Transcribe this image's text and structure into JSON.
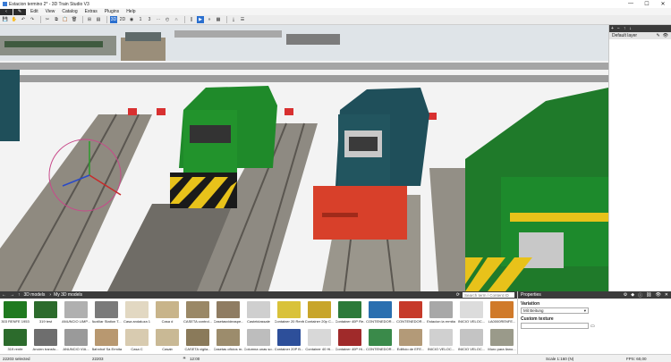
{
  "window": {
    "title": "Estacion termino 2* - 3D Train Studio V3",
    "minimize": "—",
    "maximize": "☐",
    "close": "✕"
  },
  "menu": {
    "back_icon": "arrow-left-icon",
    "edit_icon": "pencil-icon",
    "items": [
      "Edit",
      "View",
      "Catalog",
      "Extras",
      "Plugins",
      "Help"
    ]
  },
  "toolbar": {
    "view_3d": "3D",
    "view_2d": "2D",
    "counter_value": "1",
    "counter_value_2": "3",
    "pause": "||",
    "play": "▶"
  },
  "layers": {
    "default_layer": "Default layer"
  },
  "catalog": {
    "breadcrumb_1": "3D models",
    "breadcrumb_2": "My 3D models",
    "search_placeholder": "Search term / Content ID",
    "items": [
      {
        "label": "303 RENFE 1953",
        "color": "#1f7a1f"
      },
      {
        "label": "319 test",
        "color": "#2c6b2c"
      },
      {
        "label": "ANUNCIO LIMP...",
        "color": "#b0b0b0"
      },
      {
        "label": "Auxiliar Station T...",
        "color": "#7a7a7a"
      },
      {
        "label": "Casa andaluza 1",
        "color": "#e2d8c2"
      },
      {
        "label": "Casa d",
        "color": "#c8b48a"
      },
      {
        "label": "CASETA control...",
        "color": "#9a8866"
      },
      {
        "label": "Casetasvideaspe...",
        "color": "#8f7c62"
      },
      {
        "label": "Castelclassale",
        "color": "#cfcfcf"
      },
      {
        "label": "Container 20 Renfe",
        "color": "#d9c23a"
      },
      {
        "label": "Container 20p C...",
        "color": "#c8a52a"
      },
      {
        "label": "Container 40P Re...",
        "color": "#2c7a3a"
      },
      {
        "label": "CONTENEDOR...",
        "color": "#2a6fb0"
      },
      {
        "label": "CONTENEDOR...",
        "color": "#c63a2a"
      },
      {
        "label": "Estacion la ermita",
        "color": "#a8a8a8"
      },
      {
        "label": "INICIO VELOC...",
        "color": "#dcdcdc"
      },
      {
        "label": "LA0000RENFE...",
        "color": "#d07a2a"
      },
      {
        "label": "319 renfe",
        "color": "#2c6b2c"
      },
      {
        "label": "Ancien transfo...",
        "color": "#6e6e6e"
      },
      {
        "label": "ANUNCIO VIA...",
        "color": "#9a9a9a"
      },
      {
        "label": "Bahnhof Sa Ermita",
        "color": "#b89870"
      },
      {
        "label": "Casa C",
        "color": "#d8cbb0"
      },
      {
        "label": "Casab",
        "color": "#c9b995"
      },
      {
        "label": "CASETA vigila...",
        "color": "#8a7a5a"
      },
      {
        "label": "Casetas oficios m...",
        "color": "#9c8c6c"
      },
      {
        "label": "Columna unas so...",
        "color": "#bdbdbd"
      },
      {
        "label": "Container 20P B...",
        "color": "#2d4f9a"
      },
      {
        "label": "Container 40 Hi...",
        "color": "#d8d8d8"
      },
      {
        "label": "Container 40P Hi...",
        "color": "#a02a2a"
      },
      {
        "label": "CONTENEDOR...",
        "color": "#3a8a4a"
      },
      {
        "label": "Edificio de EFE...",
        "color": "#b39a78"
      },
      {
        "label": "INICIO VELOC...",
        "color": "#d0d0d0"
      },
      {
        "label": "INICIO VELOC...",
        "color": "#c4c4c4"
      },
      {
        "label": "Muro para llano...",
        "color": "#9a9a8a"
      }
    ]
  },
  "properties": {
    "title": "Properties",
    "variation_label": "Variation",
    "variation_value": "Mit Beitung",
    "custom_texture_label": "Custom texture"
  },
  "status": {
    "selected": "22203 selected",
    "id": "22203",
    "time": "12:00",
    "scale": "Scale 1:160 (N)",
    "fps": "FPS: 60,00"
  },
  "colors": {
    "dark_bar": "#3b3b3b",
    "accent": "#2a6fcf",
    "loco_green": "#1f8a2a",
    "loco_teal": "#1f4f5a",
    "loco_red": "#d8402a",
    "chevron_yellow": "#e8c21a"
  }
}
